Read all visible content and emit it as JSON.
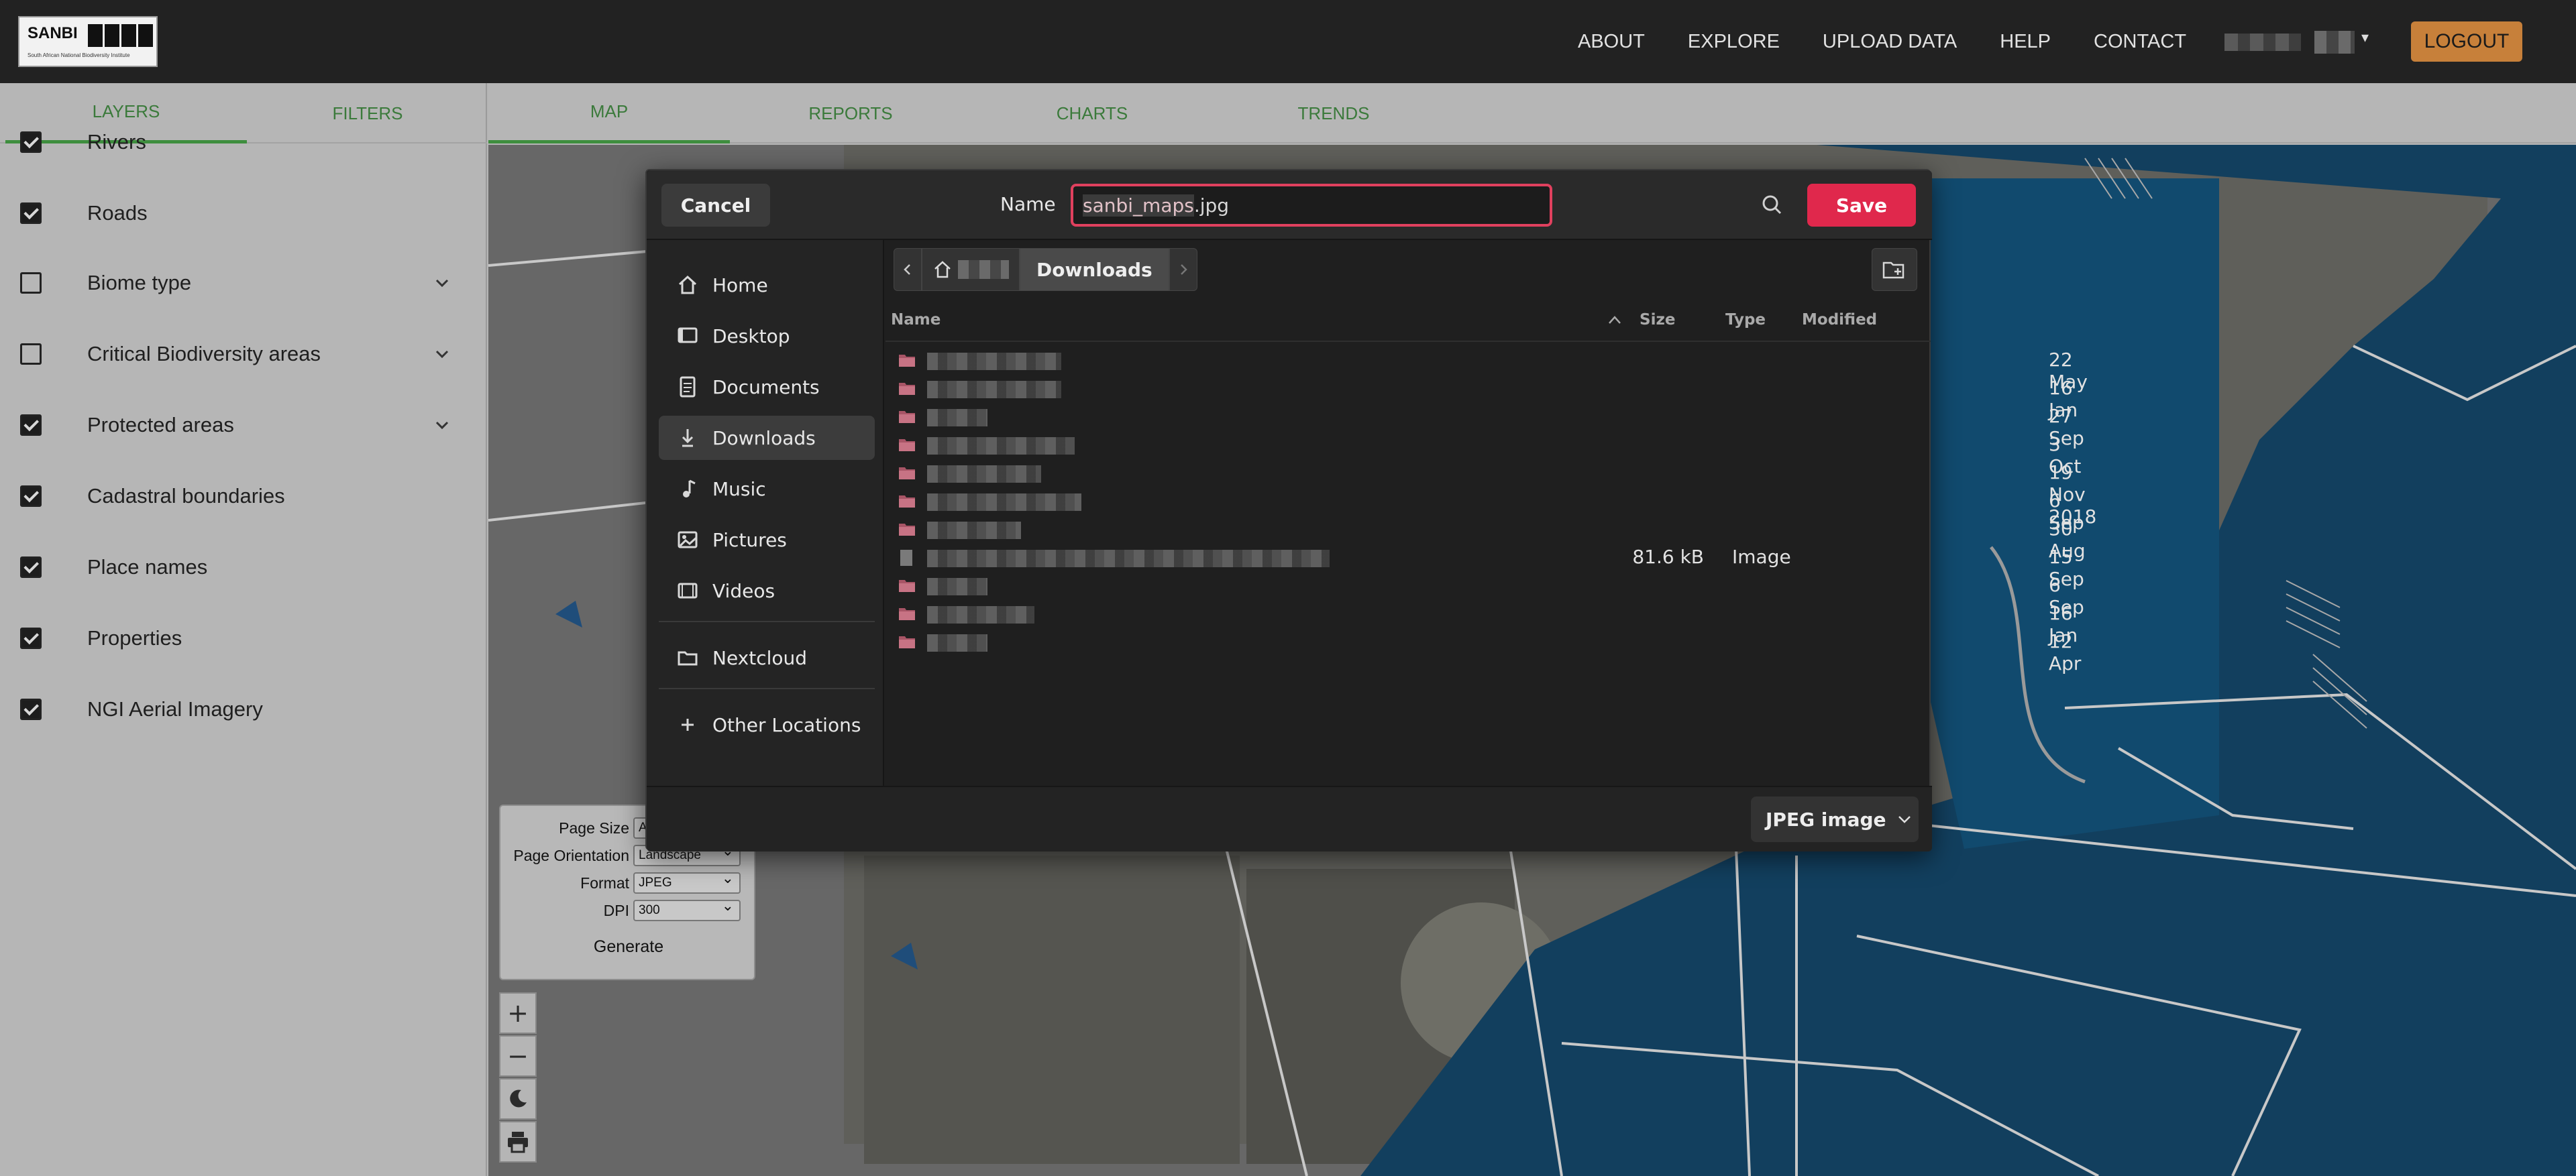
{
  "header": {
    "logo_text": "SANBI",
    "logo_subtext": "South African National Biodiversity Institute",
    "nav": [
      "ABOUT",
      "EXPLORE",
      "UPLOAD DATA",
      "HELP",
      "CONTACT"
    ],
    "logout_label": "LOGOUT"
  },
  "left_tabs": [
    "LAYERS",
    "FILTERS"
  ],
  "layers": [
    {
      "label": "Rivers",
      "checked": true,
      "expandable": false
    },
    {
      "label": "Roads",
      "checked": true,
      "expandable": false
    },
    {
      "label": "Biome type",
      "checked": false,
      "expandable": true
    },
    {
      "label": "Critical Biodiversity areas",
      "checked": false,
      "expandable": true
    },
    {
      "label": "Protected areas",
      "checked": true,
      "expandable": true
    },
    {
      "label": "Cadastral boundaries",
      "checked": true,
      "expandable": false
    },
    {
      "label": "Place names",
      "checked": true,
      "expandable": false
    },
    {
      "label": "Properties",
      "checked": true,
      "expandable": false
    },
    {
      "label": "NGI Aerial Imagery",
      "checked": true,
      "expandable": false
    }
  ],
  "main_tabs": [
    "MAP",
    "REPORTS",
    "CHARTS",
    "TRENDS"
  ],
  "print_panel": {
    "page_size_label": "Page Size",
    "page_size_value": "A4",
    "orientation_label": "Page Orientation",
    "orientation_value": "Landscape",
    "format_label": "Format",
    "format_value": "JPEG",
    "dpi_label": "DPI",
    "dpi_value": "300",
    "generate_label": "Generate"
  },
  "map_controls": {
    "zoom_in": "+",
    "zoom_out": "−"
  },
  "dialog": {
    "cancel_label": "Cancel",
    "name_label": "Name",
    "filename_selected": "sanbi_maps",
    "filename_ext": ".jpg",
    "save_label": "Save",
    "sidebar": [
      "Home",
      "Desktop",
      "Documents",
      "Downloads",
      "Music",
      "Pictures",
      "Videos",
      "Nextcloud",
      "Other Locations"
    ],
    "current_folder": "Downloads",
    "columns": {
      "name": "Name",
      "size": "Size",
      "type": "Type",
      "modified": "Modified"
    },
    "files": [
      {
        "kind": "folder",
        "size": "",
        "type": "",
        "modified": "22 May"
      },
      {
        "kind": "folder",
        "size": "",
        "type": "",
        "modified": "16 Jan"
      },
      {
        "kind": "folder",
        "size": "",
        "type": "",
        "modified": "27 Sep"
      },
      {
        "kind": "folder",
        "size": "",
        "type": "",
        "modified": "3 Oct"
      },
      {
        "kind": "folder",
        "size": "",
        "type": "",
        "modified": "19 Nov 2018"
      },
      {
        "kind": "folder",
        "size": "",
        "type": "",
        "modified": "6 Sep"
      },
      {
        "kind": "folder",
        "size": "",
        "type": "",
        "modified": "30 Aug"
      },
      {
        "kind": "file",
        "size": "81.6 kB",
        "type": "Image",
        "modified": "15 Sep"
      },
      {
        "kind": "folder",
        "size": "",
        "type": "",
        "modified": "6 Sep"
      },
      {
        "kind": "folder",
        "size": "",
        "type": "",
        "modified": "16 Jan"
      },
      {
        "kind": "folder",
        "size": "",
        "type": "",
        "modified": "12 Apr"
      }
    ],
    "filter_label": "JPEG image"
  },
  "colors": {
    "accent_green": "#3e8e3e",
    "logout_orange": "#c7803a",
    "save_red": "#e0284c",
    "water_blue": "#114a6e"
  }
}
